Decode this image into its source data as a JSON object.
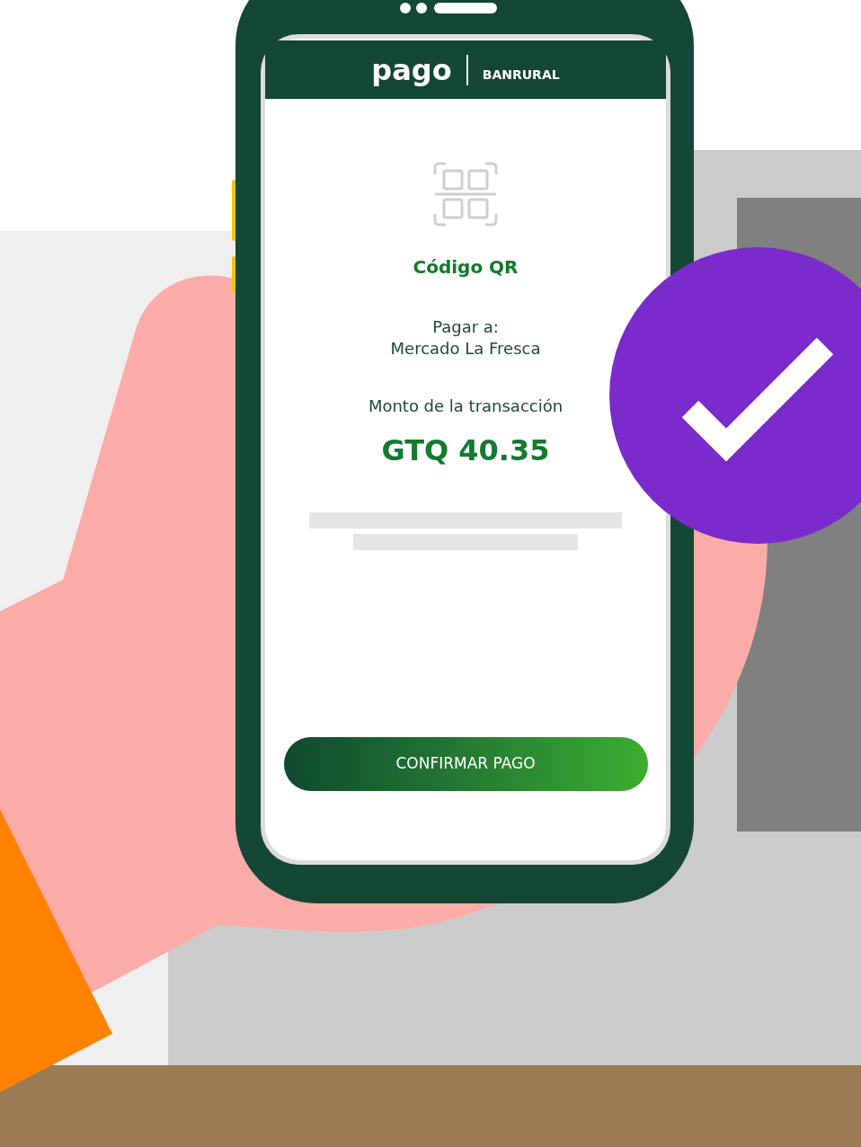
{
  "header": {
    "brand": "pago",
    "bank": "BANRURAL"
  },
  "screen": {
    "title": "Código QR",
    "pay_to_label": "Pagar a:",
    "merchant": "Mercado La Fresca",
    "amount_label": "Monto de la transacción",
    "amount": "GTQ 40.35"
  },
  "confirm_button": {
    "label": "CONFIRMAR PAGO"
  }
}
